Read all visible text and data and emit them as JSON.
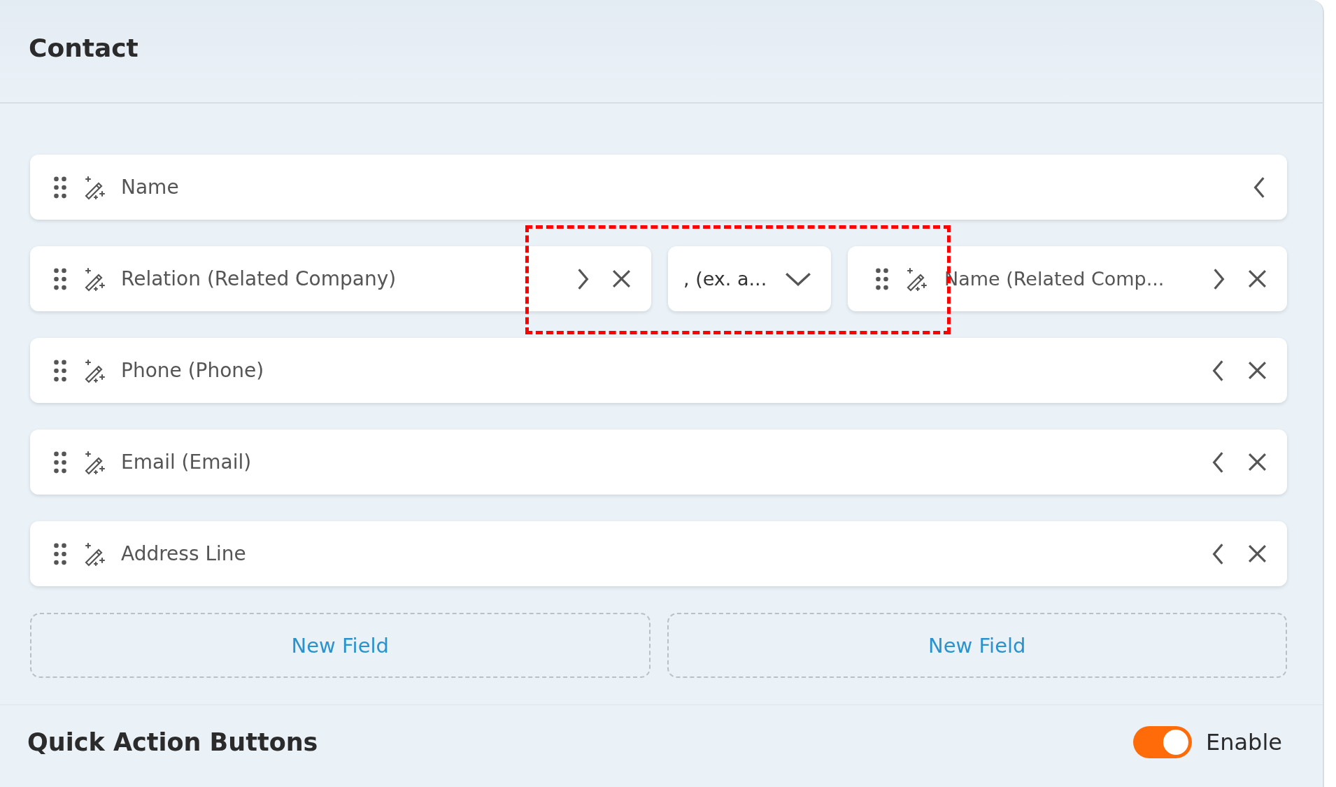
{
  "section": {
    "title": "Contact"
  },
  "rows": [
    {
      "kind": "field",
      "label": "Name",
      "expanded": false,
      "removable": false
    },
    {
      "kind": "group",
      "segments": [
        {
          "kind": "field",
          "label": "Relation (Related Company)",
          "expanded": true,
          "removable": true
        },
        {
          "kind": "separator",
          "value": ", (ex. a..."
        },
        {
          "kind": "field",
          "label": "Name (Related Comp...",
          "expanded": true,
          "removable": true
        }
      ]
    },
    {
      "kind": "field",
      "label": "Phone (Phone)",
      "expanded": false,
      "removable": true
    },
    {
      "kind": "field",
      "label": "Email (Email)",
      "expanded": false,
      "removable": true
    },
    {
      "kind": "field",
      "label": "Address Line",
      "expanded": false,
      "removable": true
    }
  ],
  "new_field_buttons": [
    "New Field",
    "New Field"
  ],
  "quick_actions": {
    "title": "Quick Action Buttons",
    "toggle": {
      "on": true,
      "label": "Enable"
    }
  }
}
